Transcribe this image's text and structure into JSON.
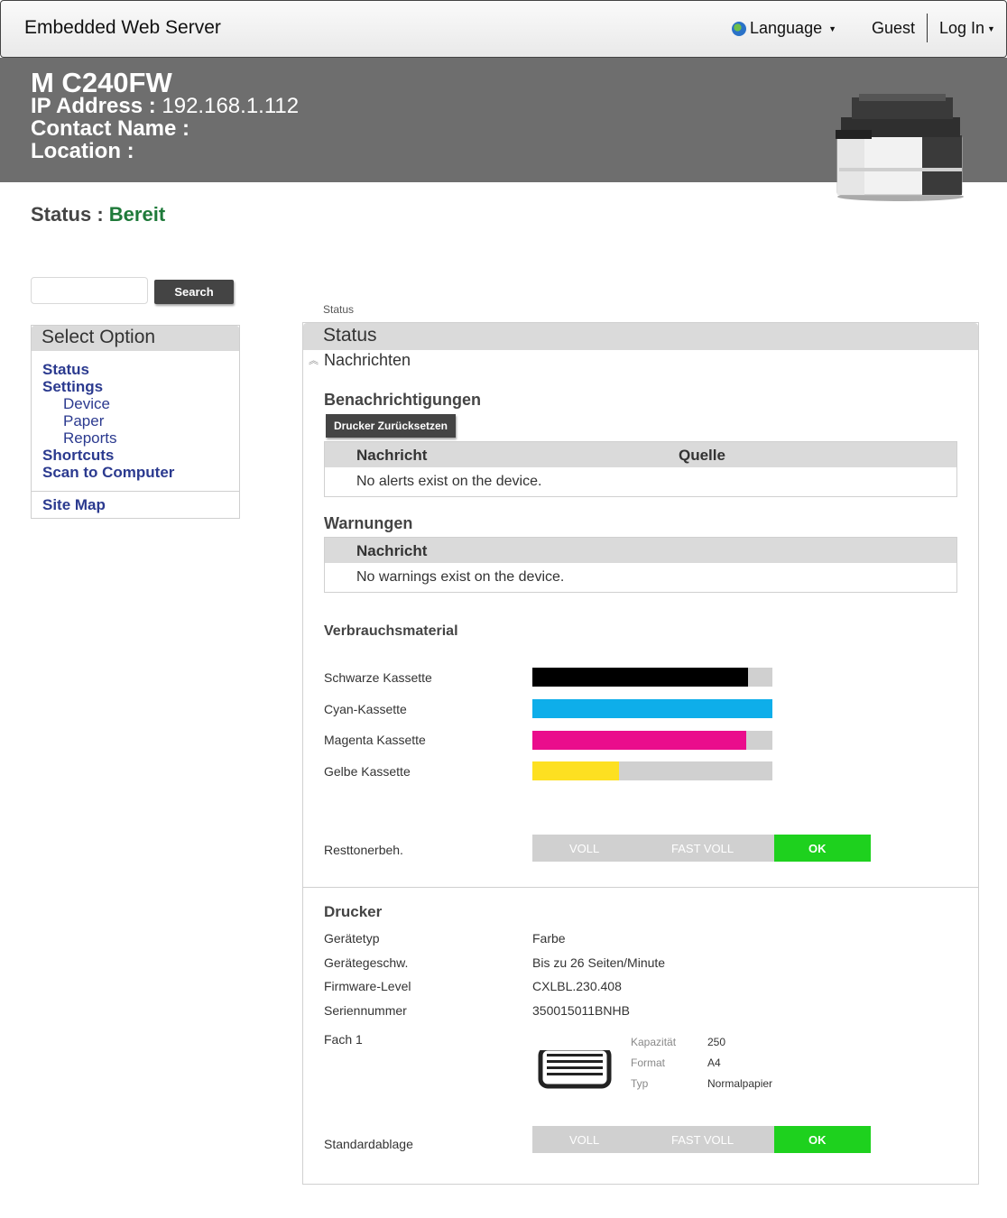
{
  "navbar": {
    "brand": "Embedded Web Server",
    "language_label": "Language",
    "guest_label": "Guest",
    "login_label": "Log In"
  },
  "header": {
    "model": "M C240FW",
    "ip_label": "IP Address : ",
    "ip_value": "192.168.1.112",
    "contact_label": "Contact Name :",
    "location_label": "Location :"
  },
  "status": {
    "label": "Status : ",
    "value": "Bereit"
  },
  "search": {
    "value": "",
    "button_label": "Search"
  },
  "sidebar": {
    "title": "Select Option",
    "items": [
      {
        "label": "Status"
      },
      {
        "label": "Settings"
      },
      {
        "label": "Device"
      },
      {
        "label": "Paper"
      },
      {
        "label": "Reports"
      },
      {
        "label": "Shortcuts"
      },
      {
        "label": "Scan to Computer"
      }
    ],
    "site_map": "Site Map"
  },
  "breadcrumb": "Status",
  "panel": {
    "title": "Status",
    "collapse_label": "Nachrichten",
    "notifications": {
      "title": "Benachrichtigungen",
      "reset_button": "Drucker Zurücksetzen",
      "col_message": "Nachricht",
      "col_source": "Quelle",
      "empty": "No alerts exist on the device."
    },
    "warnings": {
      "title": "Warnungen",
      "col_message": "Nachricht",
      "empty": "No warnings exist on the device."
    },
    "supplies": {
      "title": "Verbrauchsmaterial",
      "items": [
        {
          "label": "Schwarze Kassette",
          "level": 0.9,
          "color": "#000000"
        },
        {
          "label": "Cyan-Kassette",
          "level": 1.0,
          "color": "#0eaeea"
        },
        {
          "label": "Magenta Kassette",
          "level": 0.89,
          "color": "#ea0d8c"
        },
        {
          "label": "Gelbe Kassette",
          "level": 0.36,
          "color": "#fde021"
        }
      ],
      "waste_label": "Resttonerbeh.",
      "gauge_full": "VOLL",
      "gauge_nearly_full": "FAST VOLL",
      "gauge_ok": "OK"
    },
    "printer": {
      "title": "Drucker",
      "rows": [
        {
          "label": "Gerätetyp",
          "value": "Farbe"
        },
        {
          "label": "Gerätegeschw.",
          "value": "Bis zu 26 Seiten/Minute"
        },
        {
          "label": "Firmware-Level",
          "value": "CXLBL.230.408"
        },
        {
          "label": "Seriennummer",
          "value": "350015011BNHB"
        }
      ],
      "tray": {
        "label": "Fach 1",
        "capacity_key": "Kapazität",
        "capacity_value": "250",
        "format_key": "Format",
        "format_value": "A4",
        "type_key": "Typ",
        "type_value": "Normalpapier"
      },
      "output_label": "Standardablage",
      "gauge_full": "VOLL",
      "gauge_nearly_full": "FAST VOLL",
      "gauge_ok": "OK"
    }
  },
  "colors": {
    "header_bg": "#6e6e6e",
    "link": "#2b3a8f",
    "status_ok": "#1f7a3a",
    "gauge_ok": "#1ed11e"
  }
}
